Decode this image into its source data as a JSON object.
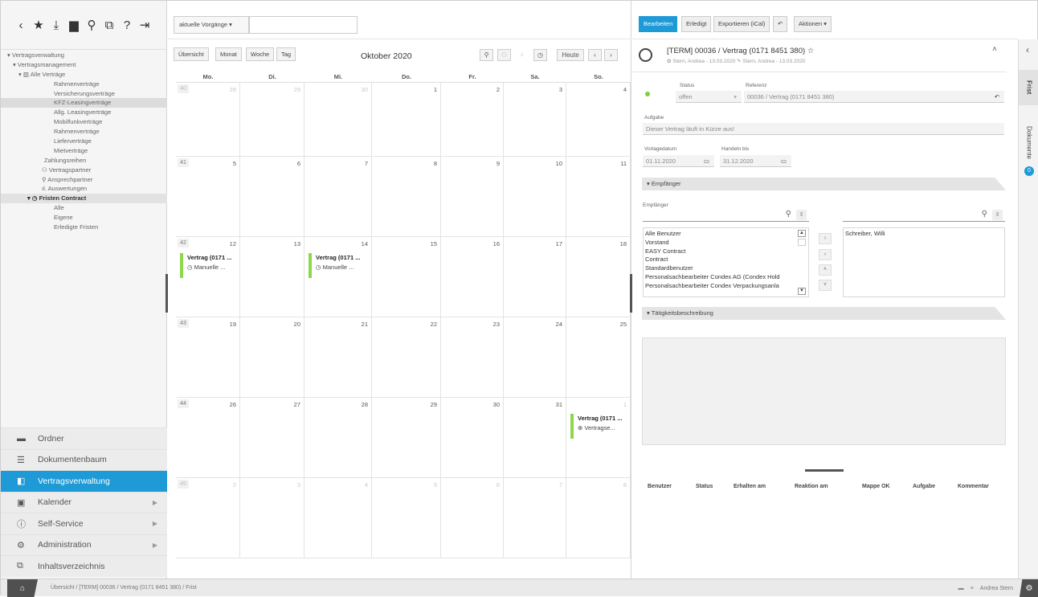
{
  "toolbar": {
    "icons": [
      "chevron-left-icon",
      "star-icon",
      "download-icon",
      "folder-icon",
      "search-icon",
      "window-icon",
      "help-icon",
      "logout-icon"
    ]
  },
  "tree": [
    {
      "label": "▾ Vertragsverwaltung",
      "indent": 8,
      "style": ""
    },
    {
      "label": "▾ Vertragsmanagement",
      "indent": 15,
      "style": ""
    },
    {
      "label": "▾ ▥ Alle Verträge",
      "indent": 22,
      "style": ""
    },
    {
      "label": "Rahmenverträge",
      "indent": 66,
      "style": ""
    },
    {
      "label": "Versicherungsverträge",
      "indent": 66,
      "style": ""
    },
    {
      "label": "KFZ-Leasingverträge",
      "indent": 66,
      "style": "sel"
    },
    {
      "label": "Allg. Leasingverträge",
      "indent": 66,
      "style": ""
    },
    {
      "label": "Mobilfunkverträge",
      "indent": 66,
      "style": ""
    },
    {
      "label": "Rahmenverträge",
      "indent": 66,
      "style": ""
    },
    {
      "label": "Lieferverträge",
      "indent": 66,
      "style": ""
    },
    {
      "label": "Mietverträge",
      "indent": 66,
      "style": ""
    },
    {
      "label": "Zahlungsreihen",
      "indent": 54,
      "style": ""
    },
    {
      "label": "⚇ Vertragspartner",
      "indent": 51,
      "style": ""
    },
    {
      "label": "⚲ Ansprechpartner",
      "indent": 51,
      "style": ""
    },
    {
      "label": "ıl. Auswertungen",
      "indent": 51,
      "style": ""
    },
    {
      "label": "▾ ◷ Fristen Contract",
      "indent": 33,
      "style": "bold frist"
    },
    {
      "label": "Alle",
      "indent": 66,
      "style": ""
    },
    {
      "label": "Eigene",
      "indent": 66,
      "style": ""
    },
    {
      "label": "Erledigte Fristen",
      "indent": 66,
      "style": ""
    }
  ],
  "nav": [
    {
      "label": "Ordner",
      "icon": "▬",
      "name": "folder-icon",
      "arrow": false,
      "active": false
    },
    {
      "label": "Dokumentenbaum",
      "icon": "☰",
      "name": "tree-icon",
      "arrow": false,
      "active": false
    },
    {
      "label": "Vertragsverwaltung",
      "icon": "◧",
      "name": "contract-icon",
      "arrow": false,
      "active": true
    },
    {
      "label": "Kalender",
      "icon": "▣",
      "name": "calendar-icon",
      "arrow": true,
      "active": false
    },
    {
      "label": "Self-Service",
      "icon": "ⓘ",
      "name": "info-icon",
      "arrow": true,
      "active": false
    },
    {
      "label": "Administration",
      "icon": "⚙",
      "name": "gear-icon",
      "arrow": true,
      "active": false
    },
    {
      "label": "Inhaltsverzeichnis",
      "icon": "⧉",
      "name": "index-icon",
      "arrow": false,
      "active": false
    }
  ],
  "status": {
    "breadcrumb": "Übersicht  /  [TERM] 00036 / Vertrag (0171 8451 380)  /  Frist",
    "user": "Andrea Stern"
  },
  "calendar": {
    "filter": "aktuelle Vorgänge ▾",
    "search_value": "",
    "views": [
      "Übersicht",
      "Monat",
      "Woche",
      "Tag"
    ],
    "month_title": "Oktober 2020",
    "today": "Heute",
    "weekdays": [
      "Mo.",
      "Di.",
      "Mi.",
      "Do.",
      "Fr.",
      "Sa.",
      "So."
    ],
    "weeks": [
      {
        "kw": "40",
        "kw_off": true,
        "days": [
          {
            "n": "28",
            "off": true
          },
          {
            "n": "29",
            "off": true
          },
          {
            "n": "30",
            "off": true
          },
          {
            "n": "1"
          },
          {
            "n": "2"
          },
          {
            "n": "3"
          },
          {
            "n": "4"
          }
        ]
      },
      {
        "kw": "41",
        "days": [
          {
            "n": "5"
          },
          {
            "n": "6"
          },
          {
            "n": "7"
          },
          {
            "n": "8"
          },
          {
            "n": "9"
          },
          {
            "n": "10"
          },
          {
            "n": "11"
          }
        ]
      },
      {
        "kw": "42",
        "days": [
          {
            "n": "12"
          },
          {
            "n": "13"
          },
          {
            "n": "14"
          },
          {
            "n": "15"
          },
          {
            "n": "16"
          },
          {
            "n": "17"
          },
          {
            "n": "18"
          }
        ]
      },
      {
        "kw": "43",
        "days": [
          {
            "n": "19"
          },
          {
            "n": "20"
          },
          {
            "n": "21"
          },
          {
            "n": "22"
          },
          {
            "n": "23"
          },
          {
            "n": "24"
          },
          {
            "n": "25"
          }
        ]
      },
      {
        "kw": "44",
        "days": [
          {
            "n": "26"
          },
          {
            "n": "27"
          },
          {
            "n": "28"
          },
          {
            "n": "29"
          },
          {
            "n": "30"
          },
          {
            "n": "31"
          },
          {
            "n": "1",
            "off": true
          }
        ]
      },
      {
        "kw": "45",
        "kw_off": true,
        "days": [
          {
            "n": "2",
            "off": true
          },
          {
            "n": "3",
            "off": true
          },
          {
            "n": "4",
            "off": true
          },
          {
            "n": "5",
            "off": true
          },
          {
            "n": "6",
            "off": true
          },
          {
            "n": "7",
            "off": true
          },
          {
            "n": "8",
            "off": true
          }
        ]
      }
    ],
    "events": [
      {
        "week": 2,
        "day": 0,
        "title": "Vertrag (0171 ...",
        "sub": "◷  Manuelle ..."
      },
      {
        "week": 2,
        "day": 2,
        "title": "Vertrag (0171 ...",
        "sub": "◷  Manuelle ..."
      },
      {
        "week": 4,
        "day": 6,
        "title": "Vertrag (0171 ...",
        "sub": "⊕  Vertragse..."
      }
    ]
  },
  "detail": {
    "buttons": [
      "Bearbeiten",
      "Erledigt",
      "Exportieren (iCal)",
      "↶",
      "Aktionen ▾"
    ],
    "title": "[TERM] 00036 / Vertrag (0171 8451 380)  ☆",
    "meta": "✿ Stern, Andrea - 13.03.2020   ✎ Stern, Andrea - 13.03.2020",
    "status_label": "Status",
    "status_value": "offen",
    "reference_label": "Referenz",
    "reference_value": "00036 / Vertrag (0171 8451 380)",
    "task_label": "Aufgabe",
    "task_value": "Dieser Vertrag läuft in Kürze aus!",
    "date1_label": "Vorlagedatum",
    "date1_value": "01.11.2020",
    "date2_label": "Handeln bis",
    "date2_value": "31.12.2020",
    "recipients_section": "▾  Empfänger",
    "recipients_label": "Empfänger",
    "recipients_left": [
      "Alle Benutzer",
      "Vorstand",
      "EASY Contract",
      "Contract",
      "Standardbenutzer",
      "Personalsachbearbeiter Condex AG (Condex Hold",
      "Personalsachbearbeiter Condex Verpackungsanla"
    ],
    "recipients_right": [
      "Schreiber, Willi"
    ],
    "activity_section": "▾  Tätigkeitsbeschreibung",
    "columns": [
      "Benutzer",
      "Status",
      "Erhalten am",
      "Reaktion am",
      "Mappe OK",
      "Aufgabe",
      "Kommentar"
    ],
    "side_tabs": [
      "Frist",
      "Dokumente"
    ],
    "side_badge": "0"
  },
  "colors": {
    "accent": "#1e9ad6",
    "event": "#8ed64a",
    "status_dot": "#7ed03c"
  }
}
